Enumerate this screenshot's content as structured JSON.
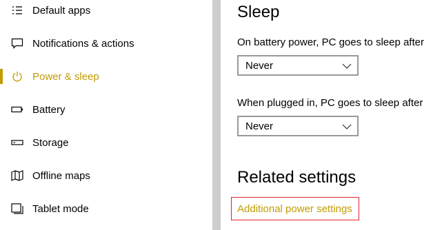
{
  "sidebar": {
    "items": [
      {
        "label": "Default apps",
        "icon": "default-apps-icon"
      },
      {
        "label": "Notifications & actions",
        "icon": "notifications-icon"
      },
      {
        "label": "Power & sleep",
        "icon": "power-icon",
        "active": true
      },
      {
        "label": "Battery",
        "icon": "battery-icon"
      },
      {
        "label": "Storage",
        "icon": "storage-icon"
      },
      {
        "label": "Offline maps",
        "icon": "map-icon"
      },
      {
        "label": "Tablet mode",
        "icon": "tablet-mode-icon"
      }
    ]
  },
  "main": {
    "sleep_heading": "Sleep",
    "battery_label": "On battery power, PC goes to sleep after",
    "battery_value": "Never",
    "plugged_label": "When plugged in, PC goes to sleep after",
    "plugged_value": "Never",
    "related_heading": "Related settings",
    "related_link": "Additional power settings"
  },
  "colors": {
    "accent": "#c19c00",
    "scroll_divider": "#cdcdcd",
    "highlight_box": "#e0202a"
  }
}
